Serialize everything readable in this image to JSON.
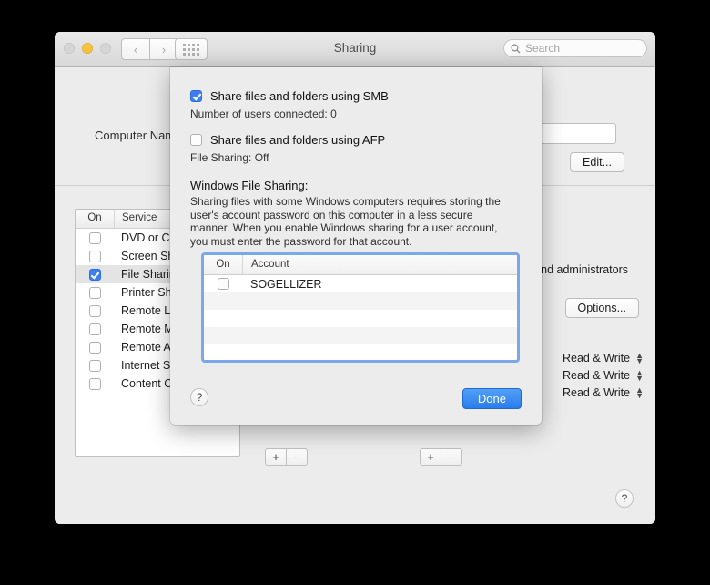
{
  "window": {
    "title": "Sharing",
    "traffic_lights": [
      "close",
      "minimize",
      "zoom"
    ],
    "nav_back": "‹",
    "nav_forward": "›",
    "grid_button": "show-all",
    "search": {
      "placeholder": "Search",
      "value": ""
    }
  },
  "prefs": {
    "computer_name_label": "Computer Nam",
    "computer_name_value": "",
    "edit_button": "Edit...",
    "admins_text": "and administrators",
    "options_button": "Options...",
    "service_table": {
      "headers": [
        "On",
        "Service"
      ],
      "rows": [
        {
          "on": false,
          "service": "DVD or CD",
          "selected": false
        },
        {
          "on": false,
          "service": "Screen Sha",
          "selected": false
        },
        {
          "on": true,
          "service": "File Sharing",
          "selected": true
        },
        {
          "on": false,
          "service": "Printer Sha",
          "selected": false
        },
        {
          "on": false,
          "service": "Remote Log",
          "selected": false
        },
        {
          "on": false,
          "service": "Remote Ma",
          "selected": false
        },
        {
          "on": false,
          "service": "Remote Ap",
          "selected": false
        },
        {
          "on": false,
          "service": "Internet Sh",
          "selected": false
        },
        {
          "on": false,
          "service": "Content Ca",
          "selected": false
        }
      ]
    },
    "permissions": [
      "Read & Write",
      "Read & Write",
      "Read & Write"
    ],
    "add_button": "+",
    "remove_button": "−",
    "help_button": "?"
  },
  "sheet": {
    "smb": {
      "label": "Share files and folders using SMB",
      "checked": true
    },
    "smb_status": "Number of users connected: 0",
    "afp": {
      "label": "Share files and folders using AFP",
      "checked": false
    },
    "afp_status": "File Sharing: Off",
    "windows_title": "Windows File Sharing:",
    "windows_body": "Sharing files with some Windows computers requires storing the user's account password on this computer in a less secure manner.  When you enable Windows sharing for a user account, you must enter the password for that account.",
    "account_table": {
      "headers": [
        "On",
        "Account"
      ],
      "rows": [
        {
          "on": false,
          "account": "SOGELLIZER"
        },
        {
          "on": false,
          "account": ""
        },
        {
          "on": false,
          "account": ""
        },
        {
          "on": false,
          "account": ""
        },
        {
          "on": false,
          "account": ""
        }
      ]
    },
    "help_button": "?",
    "done_button": "Done"
  },
  "colors": {
    "accent_blue": "#3d7ff2",
    "focus_ring": "#7aa8e8",
    "window_bg": "#ececec",
    "amber_light": "#f7c23f"
  }
}
